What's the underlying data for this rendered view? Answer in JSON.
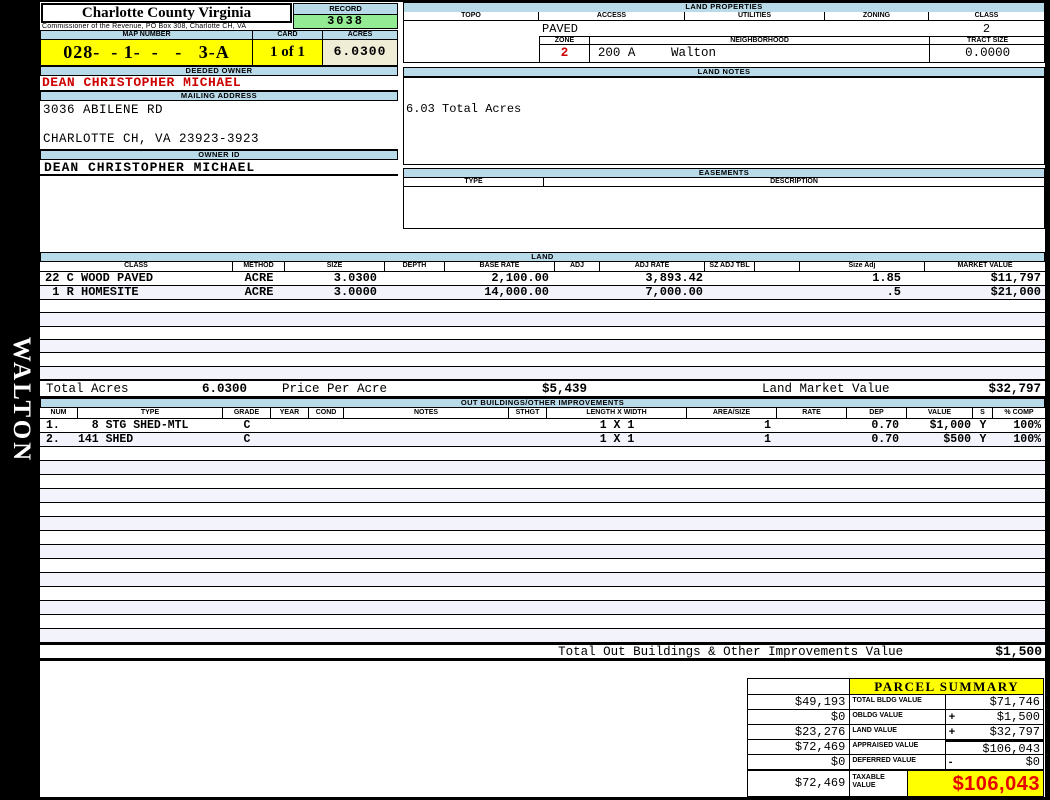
{
  "colors": {
    "header_blue": "#b9dae9",
    "highlight_yellow": "#ffff00",
    "record_green": "#93ec93",
    "acres_cream": "#f0edd6",
    "alert_red": "#cc0000",
    "big_value_red": "#e60000",
    "row_stripe": "#f2f3fb"
  },
  "sidebar": {
    "district_label": "WALTON"
  },
  "header": {
    "county": "Charlotte County Virginia",
    "office_line": "Commissioner of the Revenue, PO Box 308, Charlotte CH, VA",
    "record_label": "RECORD",
    "record_value": "3038",
    "map_number_label": "MAP NUMBER",
    "map_number_value": "028-  - 1-  -   -   3-A",
    "card_label": "CARD",
    "card_value": "1 of 1",
    "acres_label": "ACRES",
    "acres_value": "6.0300"
  },
  "owner": {
    "deeded_owner_label": "DEEDED OWNER",
    "deeded_owner": "DEAN CHRISTOPHER MICHAEL",
    "mailing_address_label": "MAILING ADDRESS",
    "address_line1": "3036 ABILENE RD",
    "address_line2": "CHARLOTTE CH, VA 23923-3923",
    "owner_id_label": "OWNER ID",
    "owner_id": "DEAN CHRISTOPHER MICHAEL"
  },
  "land_properties": {
    "title": "LAND PROPERTIES",
    "col_topo": "TOPO",
    "col_access": "ACCESS",
    "col_utilities": "UTILITIES",
    "col_zoning": "ZONING",
    "col_class": "CLASS",
    "access_value": "PAVED",
    "class_value": "2",
    "zone_label": "ZONE",
    "neighborhood_label": "NEIGHBORHOOD",
    "tract_size_label": "TRACT SIZE",
    "zone_value": "2",
    "neighborhood_code": "200 A",
    "neighborhood_name": "Walton",
    "tract_size_value": "0.0000"
  },
  "land_notes": {
    "title": "LAND NOTES",
    "note": "6.03 Total Acres"
  },
  "easements": {
    "title": "EASEMENTS",
    "col_type": "TYPE",
    "col_description": "DESCRIPTION"
  },
  "land": {
    "title": "LAND",
    "headers": [
      "CLASS",
      "METHOD",
      "SIZE",
      "DEPTH",
      "BASE RATE",
      "ADJ",
      "ADJ RATE",
      "SZ ADJ TBL",
      "",
      "Size Adj",
      "MARKET VALUE"
    ],
    "rows": [
      {
        "class": "22 C WOOD PAVED",
        "method": "ACRE",
        "size": "3.0300",
        "depth": "",
        "base_rate": "2,100.00",
        "adj": "",
        "adj_rate": "3,893.42",
        "sz_adj_tbl": "",
        "size_adj": "1.85",
        "market_value": "$11,797"
      },
      {
        "class": " 1 R HOMESITE",
        "method": "ACRE",
        "size": "3.0000",
        "depth": "",
        "base_rate": "14,000.00",
        "adj": "",
        "adj_rate": "7,000.00",
        "sz_adj_tbl": "",
        "size_adj": ".5",
        "market_value": "$21,000"
      }
    ],
    "totals": {
      "total_acres_label": "Total Acres",
      "total_acres": "6.0300",
      "price_per_acre_label": "Price Per Acre",
      "price_per_acre": "$5,439",
      "land_market_value_label": "Land Market Value",
      "land_market_value": "$32,797"
    }
  },
  "outbuildings": {
    "title": "OUT BUILDINGS/OTHER IMPROVEMENTS",
    "headers": [
      "NUM",
      "TYPE",
      "GRADE",
      "YEAR",
      "COND",
      "NOTES",
      "STHGT",
      "LENGTH X WIDTH",
      "AREA/SIZE",
      "RATE",
      "DEP",
      "VALUE",
      "S",
      "% COMP"
    ],
    "rows": [
      {
        "num": "1.",
        "type": "  8 STG SHED-MTL",
        "grade": "C",
        "year": "",
        "cond": "",
        "notes": "",
        "sthgt": "",
        "length_width": "1 X 1",
        "area_size": "1",
        "rate": "",
        "dep": "0.70",
        "value": "$1,000",
        "s": "Y",
        "pct_comp": "100%"
      },
      {
        "num": "2.",
        "type": "141 SHED",
        "grade": "C",
        "year": "",
        "cond": "",
        "notes": "",
        "sthgt": "",
        "length_width": "1 X 1",
        "area_size": "1",
        "rate": "",
        "dep": "0.70",
        "value": "$500",
        "s": "Y",
        "pct_comp": "100%"
      }
    ],
    "total_label": "Total Out Buildings & Other Improvements Value",
    "total_value": "$1,500"
  },
  "parcel_summary": {
    "title": "PARCEL SUMMARY",
    "rows": [
      {
        "left": "$49,193",
        "label": "TOTAL BLDG VALUE",
        "op": "",
        "value": "$71,746"
      },
      {
        "left": "$0",
        "label": "OBLDG VALUE",
        "op": "+",
        "value": "$1,500"
      },
      {
        "left": "$23,276",
        "label": "LAND VALUE",
        "op": "+",
        "value": "$32,797"
      },
      {
        "left": "$72,469",
        "label": "APPRAISED VALUE",
        "op": "",
        "value": "$106,043"
      },
      {
        "left": "$0",
        "label": "DEFERRED VALUE",
        "op": "-",
        "value": "$0"
      }
    ],
    "taxable_left": "$72,469",
    "taxable_label": "TAXABLE VALUE",
    "taxable_value": "$106,043"
  }
}
